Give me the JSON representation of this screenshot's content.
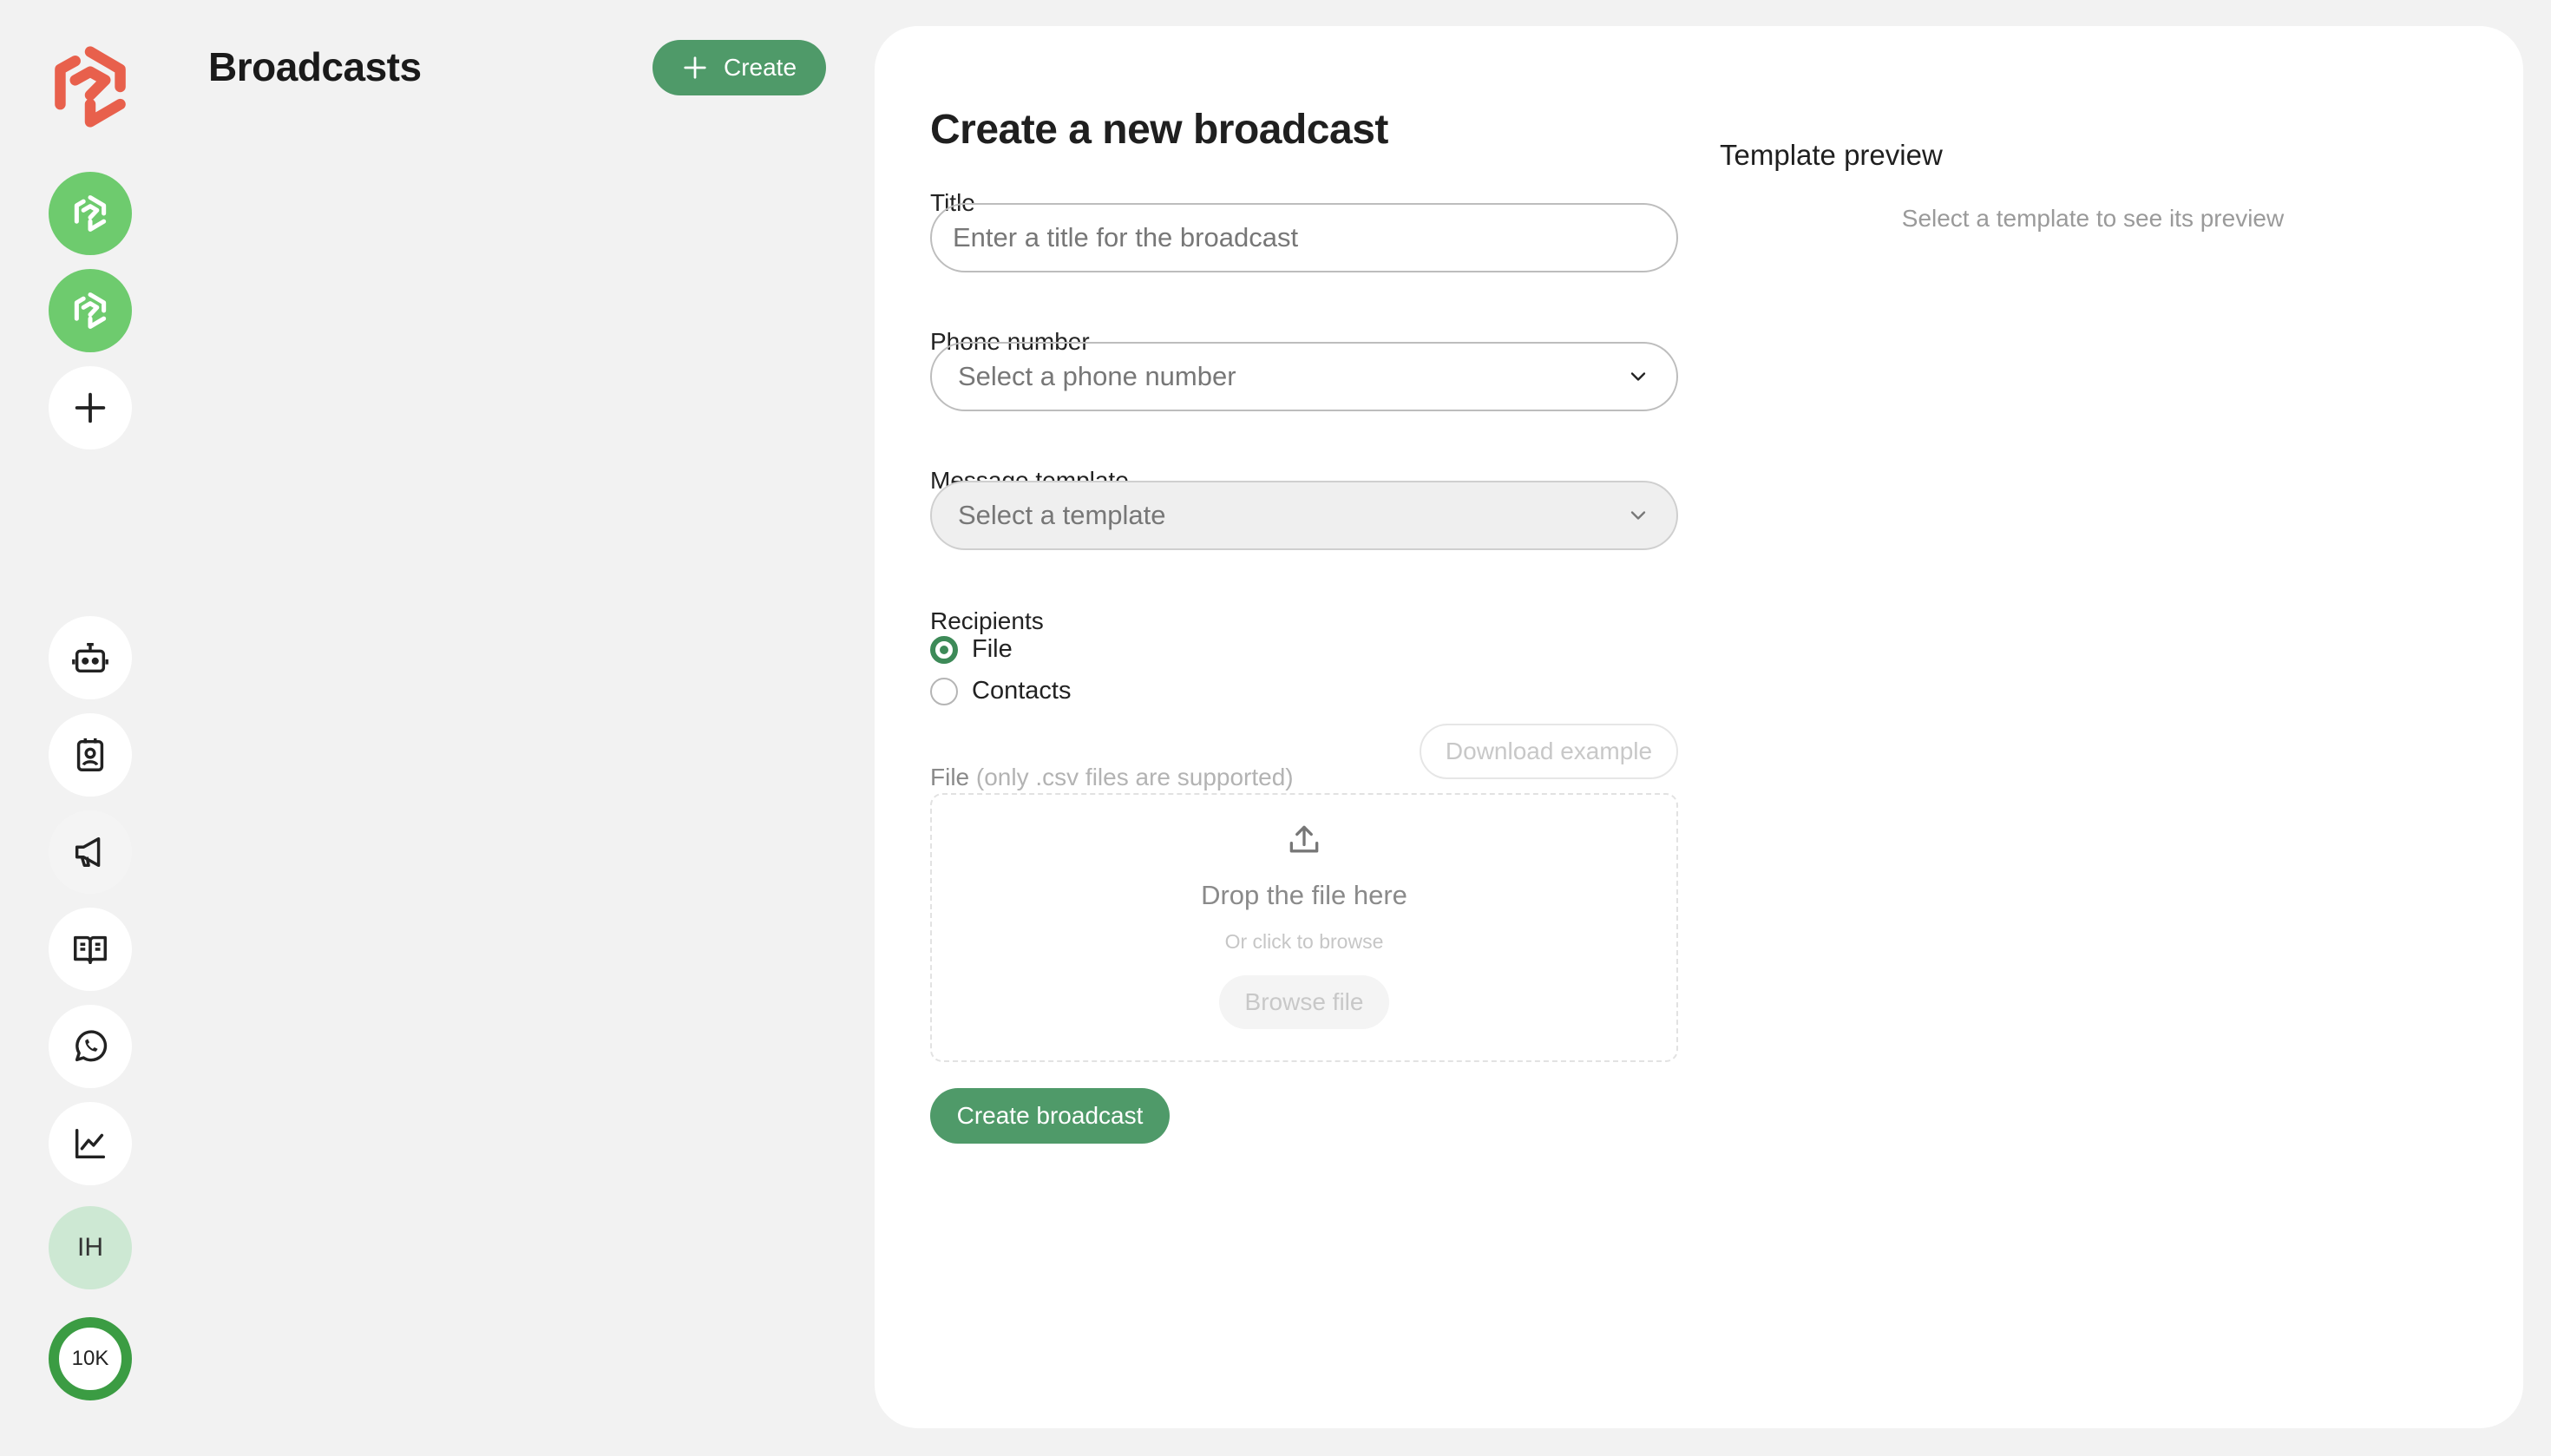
{
  "rail": {
    "workspace_add_label": "+",
    "avatar_initials": "IH",
    "credits_badge": "10K",
    "colors": {
      "brand_red": "#e8604c",
      "workspace_green": "#6ecb6e",
      "credits_ring": "#3b9c43"
    },
    "icons": [
      "app-logo-icon",
      "workspace-logo-icon",
      "workspace-logo-icon",
      "plus-icon",
      "bot-icon",
      "contact-card-icon",
      "megaphone-icon",
      "book-icon",
      "whatsapp-icon",
      "chart-line-icon"
    ]
  },
  "list": {
    "title": "Broadcasts",
    "create_label": "Create"
  },
  "form": {
    "title": "Create a new broadcast",
    "title_label": "Title",
    "title_placeholder": "Enter a title for the broadcast",
    "phone_label": "Phone number",
    "phone_value": "Select a phone number",
    "template_label": "Message template",
    "template_value": "Select a template",
    "recipients_label": "Recipients",
    "recipients_options": [
      {
        "label": "File",
        "selected": true
      },
      {
        "label": "Contacts",
        "selected": false
      }
    ],
    "file_label": "File",
    "file_hint": "(only .csv files are supported)",
    "download_example_label": "Download example",
    "dropzone_title": "Drop the file here",
    "dropzone_subtitle": "Or click to browse",
    "browse_label": "Browse file",
    "submit_label": "Create broadcast",
    "accent_color": "#4f9a69"
  },
  "preview": {
    "title": "Template preview",
    "placeholder": "Select a template to see its preview"
  }
}
